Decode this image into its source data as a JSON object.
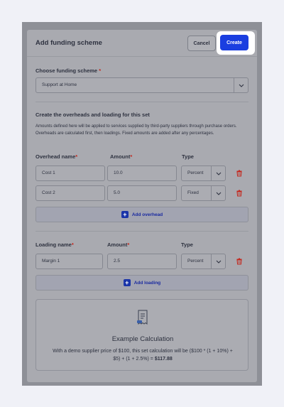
{
  "modal": {
    "title": "Add funding scheme",
    "cancel_label": "Cancel",
    "create_label": "Create"
  },
  "scheme": {
    "label": "Choose funding scheme",
    "value": "Support at Home"
  },
  "overheads_section": {
    "title": "Create the overheads and loading for this set",
    "description": "Amounts defined here will be applied to services supplied by third-party suppliers through purchase orders. Overheads are calculated first, then loadings. Fixed amounts are added after any percentages."
  },
  "overheads": {
    "name_header": "Overhead name",
    "amount_header": "Amount",
    "type_header": "Type",
    "rows": [
      {
        "name": "Cost 1",
        "amount": "10.0",
        "type": "Percent"
      },
      {
        "name": "Cost 2",
        "amount": "5.0",
        "type": "Fixed"
      }
    ],
    "add_label": "Add overhead"
  },
  "loadings": {
    "name_header": "Loading name",
    "amount_header": "Amount",
    "type_header": "Type",
    "rows": [
      {
        "name": "Margin 1",
        "amount": "2.5",
        "type": "Percent"
      }
    ],
    "add_label": "Add loading"
  },
  "example": {
    "title": "Example Calculation",
    "text": "With a demo supplier price of $100, this set calculation will be ($100 * (1 + 10%) + $5) + (1 + 2.5%) =",
    "total": "$117.88"
  },
  "colors": {
    "primary": "#1a3ee0",
    "delete": "#c4271d"
  }
}
